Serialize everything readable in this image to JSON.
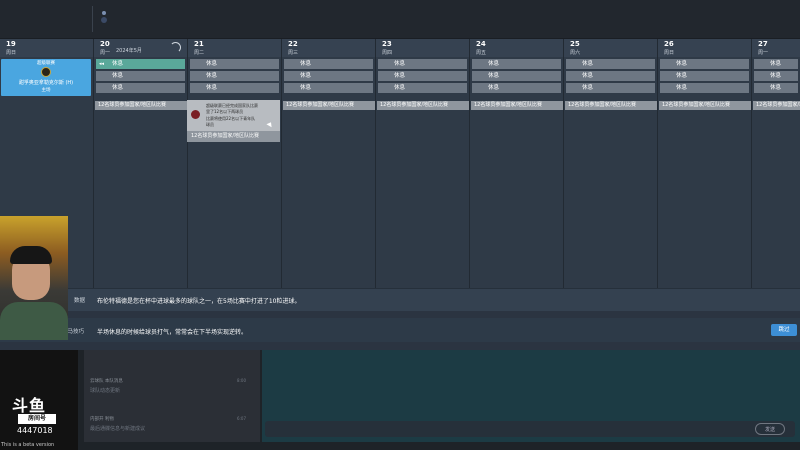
{
  "calendar": {
    "month_label": "2024年5月",
    "days": [
      {
        "num": "19",
        "wk": "周日"
      },
      {
        "num": "20",
        "wk": "周一"
      },
      {
        "num": "21",
        "wk": "周二"
      },
      {
        "num": "22",
        "wk": "周三"
      },
      {
        "num": "23",
        "wk": "周四"
      },
      {
        "num": "24",
        "wk": "周五"
      },
      {
        "num": "25",
        "wk": "周六"
      },
      {
        "num": "26",
        "wk": "周日"
      },
      {
        "num": "27",
        "wk": "周一"
      }
    ],
    "rest_label": "休息",
    "match_card": {
      "top": "超级联赛",
      "teams": "甜孚奥亚拿勒克尔斯 (H)",
      "bottom": "主场"
    },
    "match_bar": "12名球员参加国家/地区队比赛"
  },
  "popup": {
    "line1": "超级联赛已经完成国家队比赛",
    "line2": "里了12名以下两球员",
    "line3": "比赛将使用22名以下青年队",
    "line4": "球员",
    "footer": "12名球员参加国家/地区队比赛"
  },
  "info": {
    "label": "数据",
    "text": "布伦特福德是您在杯中进球最多的球队之一，在5场比赛中打进了10粒进球。"
  },
  "tip": {
    "label": "1马技巧",
    "text": "半场休息的时候给球员打气，常常会在下半场实现逆转。",
    "skip": "跳过"
  },
  "news": [
    {
      "meta": "云球队 本队消息",
      "title": "球队动态更新",
      "time": "8:00"
    },
    {
      "meta": "内部开 利物",
      "title": "最后通牒信息与新建成议",
      "time": "6:07"
    }
  ],
  "stream": {
    "brand": "斗鱼",
    "room_label": "房间号",
    "room_num": "4447018",
    "beta": "This is a beta version"
  },
  "chat": {
    "send": "发送"
  }
}
